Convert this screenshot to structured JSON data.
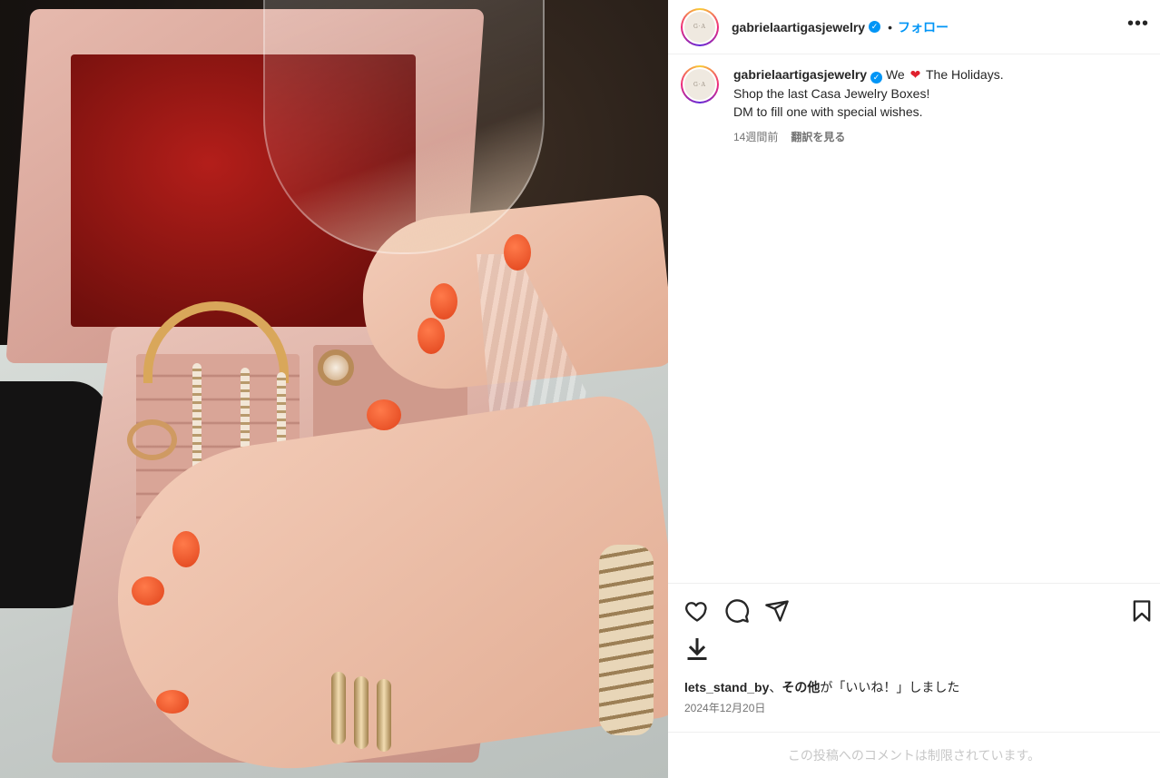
{
  "post": {
    "account": {
      "username": "gabrielaartigasjewelry",
      "verified_mark": "✓",
      "avatar_monogram": "G·A"
    },
    "header": {
      "separator": "•",
      "follow_label": "フォロー",
      "more_label": "•••"
    },
    "caption": {
      "line1_before": "We",
      "heart": "❤",
      "line1_after": "The Holidays.",
      "line2": "Shop the last Casa Jewelry Boxes!",
      "line3": "DM to fill one with special wishes.",
      "time_ago": "14週間前",
      "translate_label": "翻訳を見る"
    },
    "actions": {
      "icons": [
        "heart-icon",
        "comment-icon",
        "share-icon",
        "bookmark-icon",
        "download-icon"
      ]
    },
    "likes": {
      "liker": "lets_stand_by",
      "separator": "、",
      "others": "その他",
      "suffix": "が「いいね！」しました"
    },
    "date": "2024年12月20日",
    "comments_disabled": "この投稿へのコメントは制限されています。"
  },
  "colors": {
    "accent_blue": "#0095f6",
    "heart_red": "#e0212e",
    "muted_text": "#737373",
    "disabled_text": "#c7c7c7"
  }
}
